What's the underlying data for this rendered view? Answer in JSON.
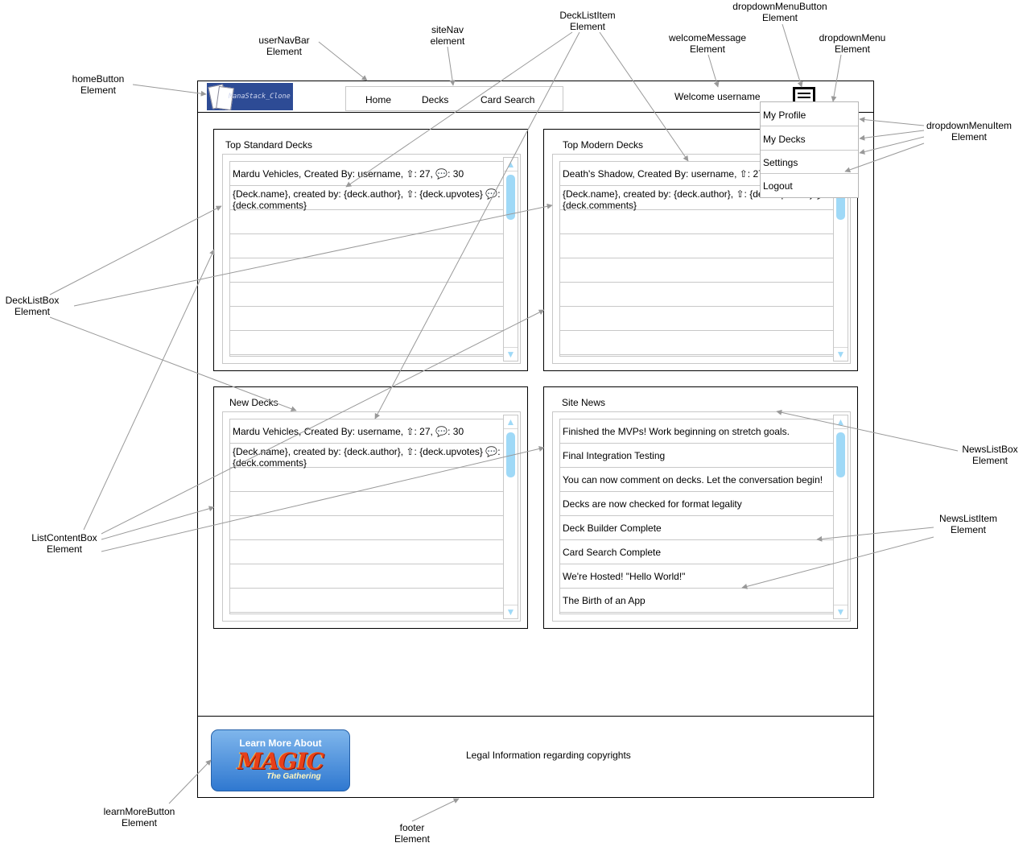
{
  "annotations": {
    "homeButton": [
      "homeButton",
      "Element"
    ],
    "userNavBar": [
      "userNavBar",
      "Element"
    ],
    "siteNav": [
      "siteNav",
      "element"
    ],
    "deckListItem": [
      "DeckListItem",
      "Element"
    ],
    "welcomeMessage": [
      "welcomeMessage",
      "Element"
    ],
    "dropdownMenuButton": [
      "dropdownMenuButton",
      "Element"
    ],
    "dropdownMenu": [
      "dropdownMenu",
      "Element"
    ],
    "dropdownMenuItem": [
      "dropdownMenuItem",
      "Element"
    ],
    "deckListBox": [
      "DeckListBox",
      "Element"
    ],
    "newsListBox": [
      "NewsListBox",
      "Element"
    ],
    "newsListItem": [
      "NewsListItem",
      "Element"
    ],
    "listContentBox": [
      "ListContentBox",
      "Element"
    ],
    "learnMoreButton": [
      "learnMoreButton",
      "Element"
    ],
    "footer": [
      "footer",
      "Element"
    ]
  },
  "header": {
    "home_logo_text": "ManaStack_Clone",
    "nav": [
      "Home",
      "Decks",
      "Card Search"
    ],
    "welcome": "Welcome username",
    "menu_icon": "hamburger-menu-icon"
  },
  "dropdown": [
    "My Profile",
    "My Decks",
    "Settings",
    "Logout"
  ],
  "boxes": {
    "top_standard": {
      "title": "Top Standard Decks",
      "row1": "Mardu Vehicles, Created By: username, ⇧: 27, 💬: 30",
      "row2": "{Deck.name}, created by: {deck.author}, ⇧: {deck.upvotes} 💬: {deck.comments}"
    },
    "top_modern": {
      "title": "Top Modern Decks",
      "row1": "Death's Shadow, Created By: username, ⇧: 27,",
      "row2": "{Deck.name}, created by: {deck.author}, ⇧: {deck.upvotes} 💬: {deck.comments}"
    },
    "new_decks": {
      "title": "New Decks",
      "row1": "Mardu Vehicles, Created By: username, ⇧: 27, 💬: 30",
      "row2": "{Deck.name}, created by: {deck.author}, ⇧: {deck.upvotes} 💬: {deck.comments}"
    },
    "site_news": {
      "title": "Site News",
      "items": [
        "Finished the MVPs! Work beginning on stretch goals.",
        "Final Integration Testing",
        "You can now comment on decks. Let the conversation begin!",
        "Decks are now checked for format legality",
        "Deck Builder Complete",
        "Card Search Complete",
        "We're Hosted! \"Hello World!\"",
        "The Birth of an App"
      ]
    }
  },
  "scroll_arrows": {
    "up": "▲",
    "down": "▼"
  },
  "footer": {
    "learn_more_top": "Learn More About",
    "learn_more_brand": "MAGIC",
    "learn_more_sub": "The Gathering",
    "legal": "Legal Information regarding copyrights"
  },
  "colors": {
    "scrollbar": "#9fd9f7",
    "home_button_bg": "#2d4b95",
    "arrow": "#999999"
  }
}
